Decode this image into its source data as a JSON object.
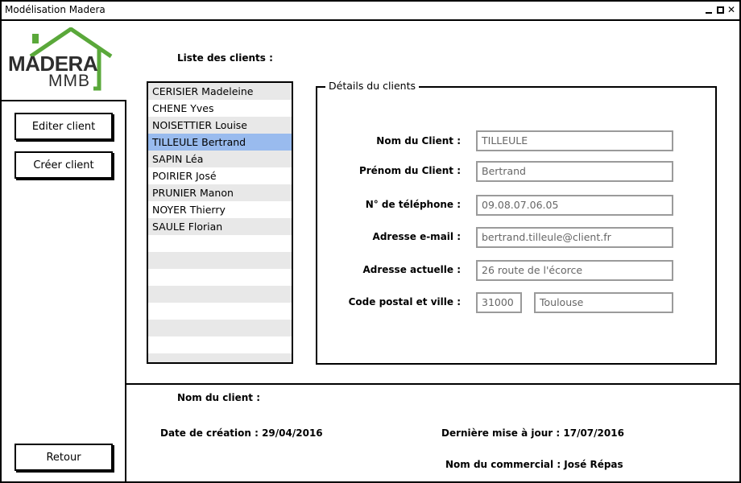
{
  "window": {
    "title": "Modélisation Madera"
  },
  "logo": {
    "word": "MADERA",
    "sub": "MMB",
    "roof_color": "#5aa83a",
    "text_color": "#2e2e2e"
  },
  "sidebar": {
    "edit_label": "Editer client",
    "create_label": "Créer client",
    "back_label": "Retour"
  },
  "clients": {
    "label": "Liste des clients :",
    "items": [
      "CERISIER Madeleine",
      "CHENE Yves",
      "NOISETTIER Louise",
      "TILLEULE Bertrand",
      "SAPIN Léa",
      "POIRIER José",
      "PRUNIER Manon",
      "NOYER Thierry",
      "SAULE Florian"
    ],
    "selected_index": 3,
    "selected_color": "#99bbee",
    "empty_rows": 8
  },
  "details": {
    "legend": "Détails du clients",
    "nom_label": "Nom du Client :",
    "nom_value": "TILLEULE",
    "prenom_label": "Prénom du Client :",
    "prenom_value": "Bertrand",
    "tel_label": "N° de téléphone :",
    "tel_value": "09.08.07.06.05",
    "email_label": "Adresse e-mail :",
    "email_value": "bertrand.tilleule@client.fr",
    "adresse_label": "Adresse actuelle :",
    "adresse_value": "26 route de l'écorce",
    "cp_label": "Code postal et ville :",
    "cp_value": "31000",
    "ville_value": "Toulouse"
  },
  "info": {
    "nom_client": "Nom du client :",
    "date_creation": "Date de création : 29/04/2016",
    "derniere_maj": "Dernière mise à jour : 17/07/2016",
    "commercial": "Nom du commercial : José Répas"
  }
}
